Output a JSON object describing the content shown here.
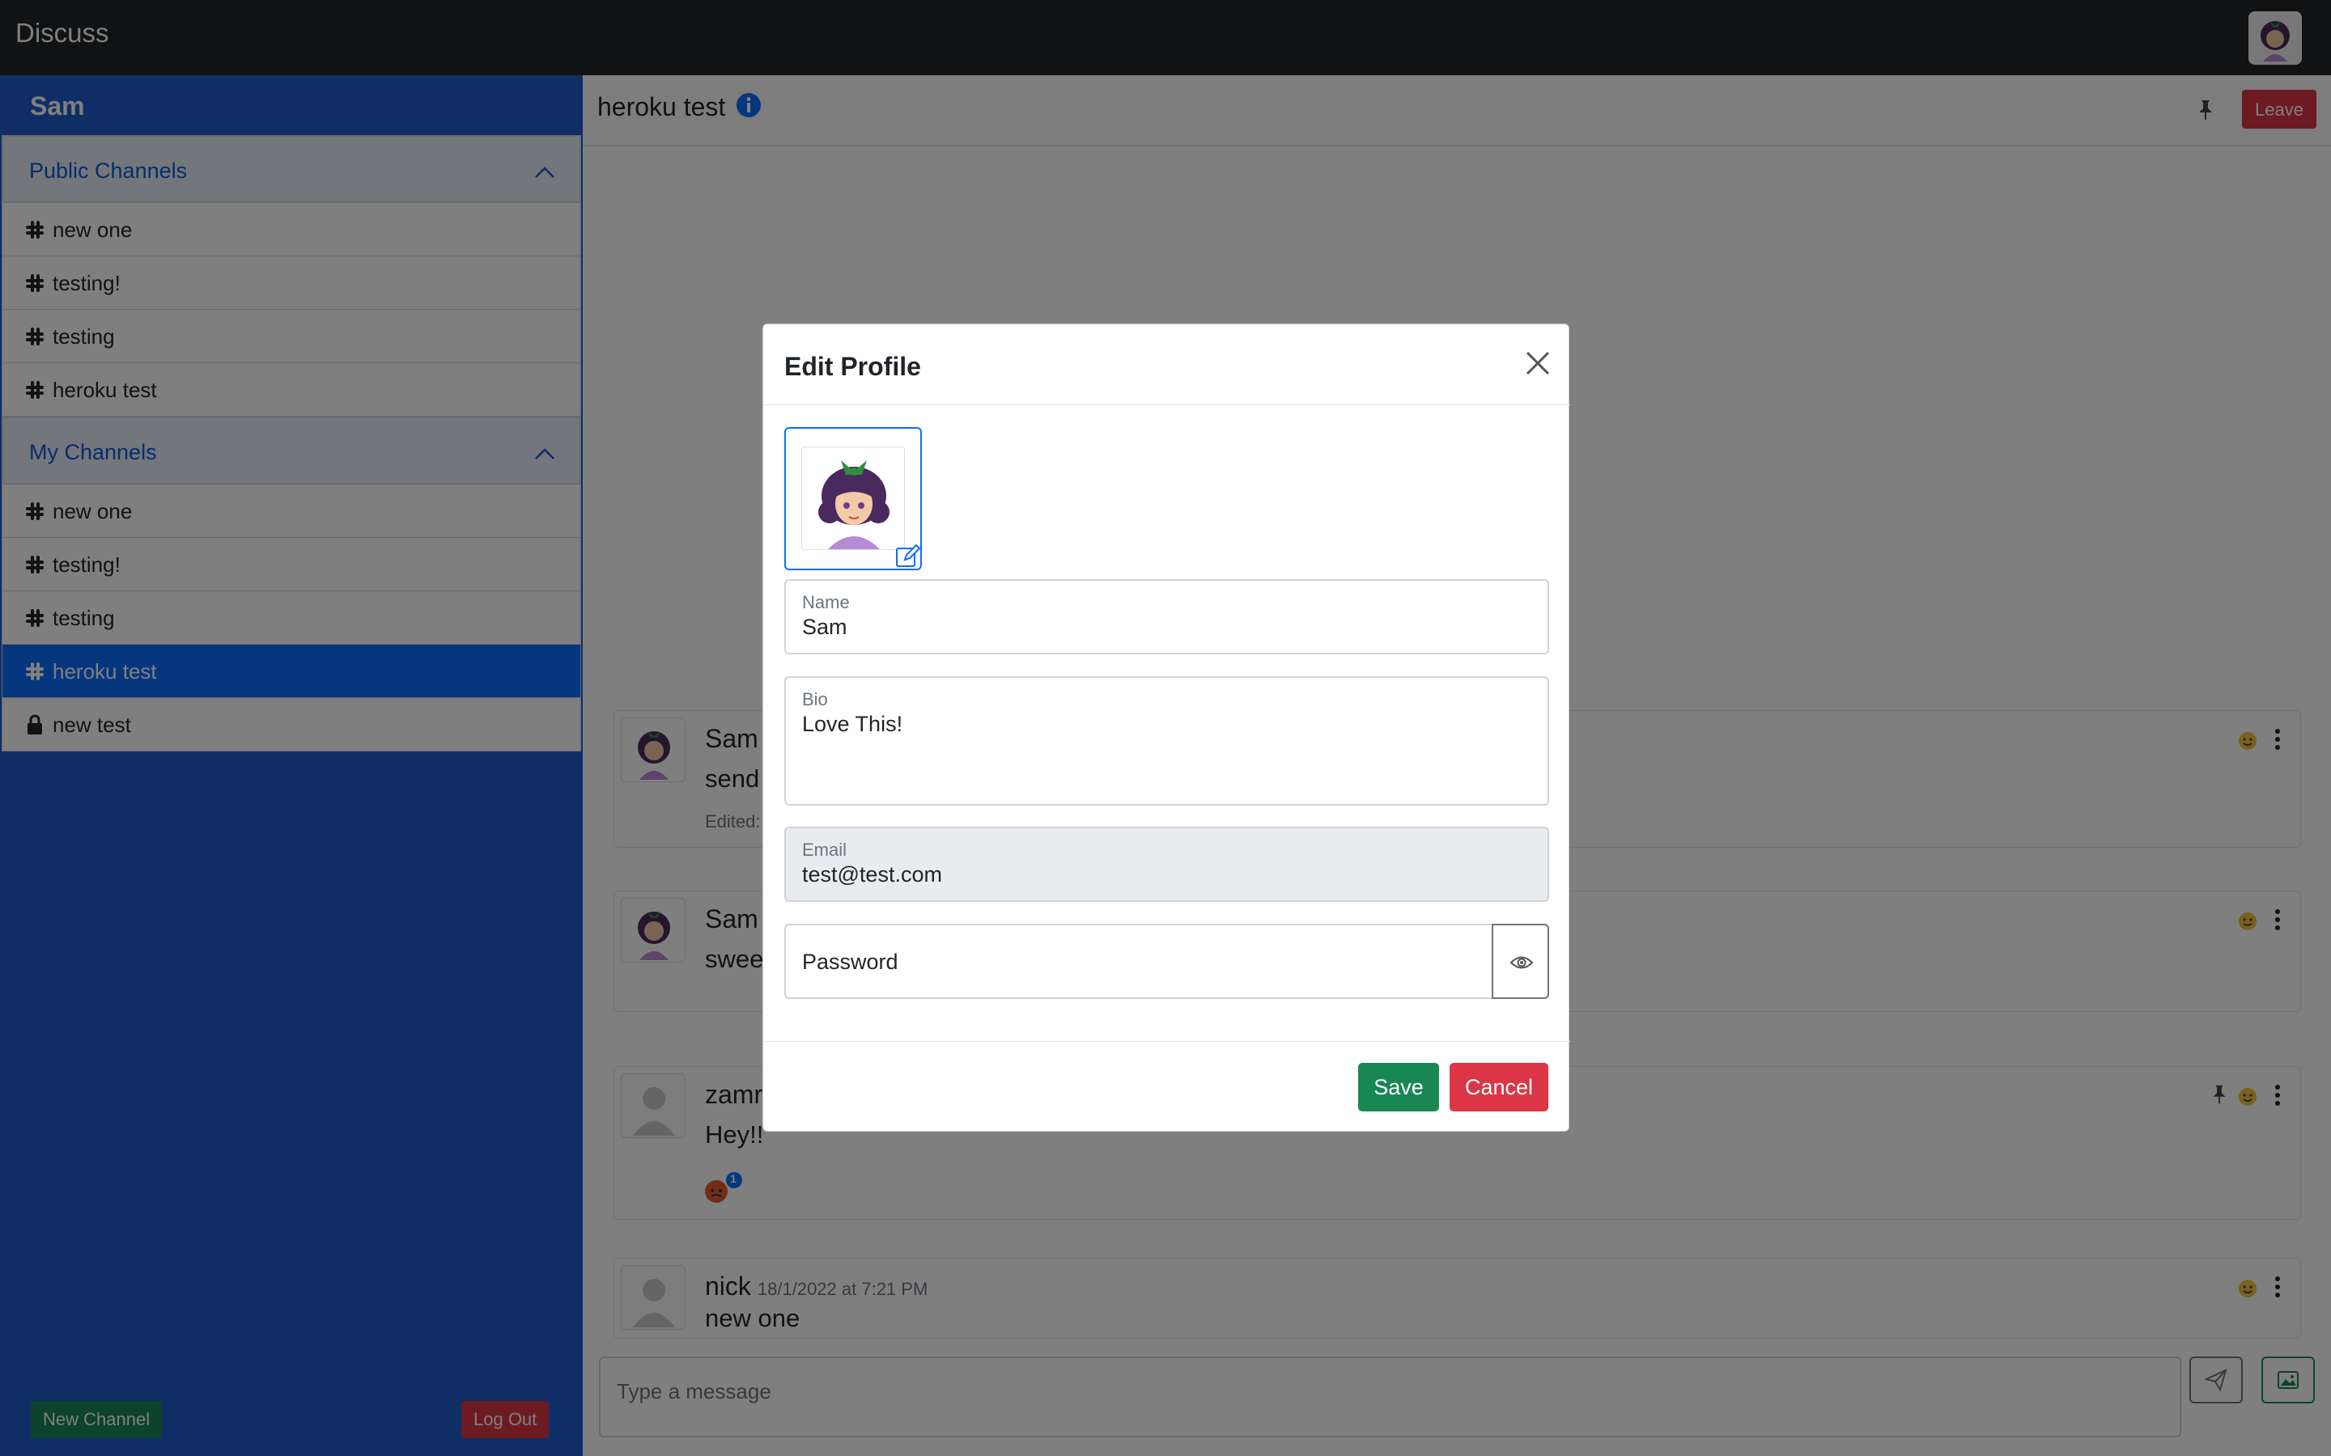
{
  "app": {
    "brand": "Discuss"
  },
  "sidebar": {
    "user_name": "Sam",
    "public_section_label": "Public Channels",
    "public_channels": [
      {
        "label": "new one",
        "icon": "slack-hash-icon"
      },
      {
        "label": "testing!",
        "icon": "slack-hash-icon"
      },
      {
        "label": "testing",
        "icon": "slack-hash-icon"
      },
      {
        "label": "heroku test",
        "icon": "slack-hash-icon"
      }
    ],
    "my_section_label": "My Channels",
    "my_channels": [
      {
        "label": "new one",
        "icon": "slack-hash-icon"
      },
      {
        "label": "testing!",
        "icon": "slack-hash-icon"
      },
      {
        "label": "testing",
        "icon": "slack-hash-icon"
      },
      {
        "label": "heroku test",
        "icon": "slack-hash-icon",
        "active": true
      },
      {
        "label": "new test",
        "icon": "lock-icon"
      }
    ],
    "new_channel_label": "New Channel",
    "logout_label": "Log Out"
  },
  "chat": {
    "title": "heroku test",
    "leave_label": "Leave",
    "messages": [
      {
        "author": "Sam",
        "text": "send",
        "edited": "Edited:"
      },
      {
        "author": "Sam",
        "text": "swee"
      },
      {
        "author": "zamr",
        "text": "Hey!!",
        "reaction_count": "1"
      },
      {
        "author": "nick",
        "time": "18/1/2022 at 7:21 PM",
        "text": "new one"
      }
    ],
    "composer_placeholder": "Type a message"
  },
  "modal": {
    "title": "Edit Profile",
    "name_label": "Name",
    "name_value": "Sam",
    "bio_label": "Bio",
    "bio_value": "Love This!",
    "email_label": "Email",
    "email_value": "test@test.com",
    "password_placeholder": "Password",
    "save_label": "Save",
    "cancel_label": "Cancel"
  },
  "colors": {
    "sidebar": "#1e5ccd",
    "active_item": "#0d6efd",
    "success": "#198754",
    "danger": "#dc3545",
    "navbar": "#212529"
  }
}
